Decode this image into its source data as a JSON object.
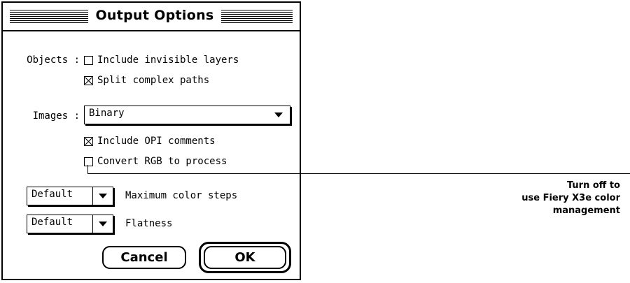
{
  "dialog": {
    "title": "Output Options",
    "objects_label": "Objects :",
    "include_invisible_layers": {
      "label": "Include invisible layers",
      "checked": false
    },
    "split_complex_paths": {
      "label": "Split complex paths",
      "checked": true
    },
    "images_label": "Images :",
    "images_select": {
      "value": "Binary"
    },
    "include_opi_comments": {
      "label": "Include OPI comments",
      "checked": true
    },
    "convert_rgb_to_process": {
      "label": "Convert RGB to process",
      "checked": false
    },
    "max_color_steps": {
      "value": "Default",
      "label": "Maximum color steps"
    },
    "flatness": {
      "value": "Default",
      "label": "Flatness"
    },
    "cancel_label": "Cancel",
    "ok_label": "OK"
  },
  "callout": {
    "lines": [
      "Turn off to",
      "use Fiery X3e color",
      "management"
    ]
  }
}
